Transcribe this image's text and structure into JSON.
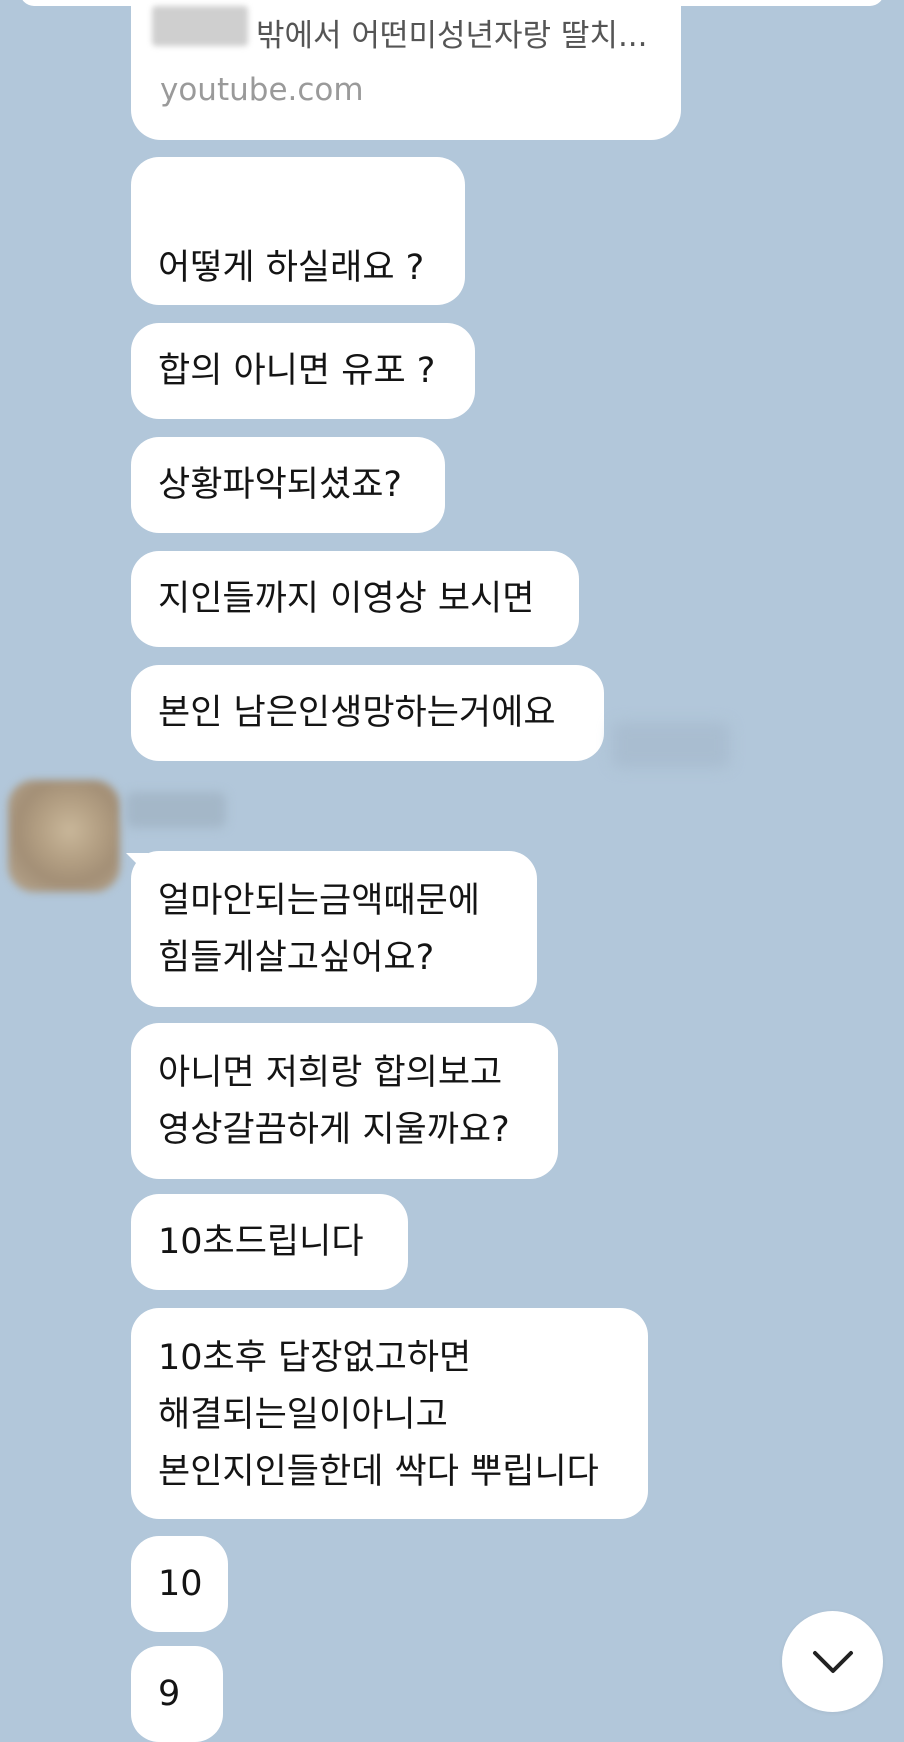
{
  "link_preview": {
    "title": "밖에서 어떤미성년자랑 딸치...",
    "domain": "youtube.com"
  },
  "messages": [
    "어떻게 하실래요 ?",
    "합의 아니면 유포 ?",
    "상황파악되셨죠?",
    "지인들까지 이영상 보시면",
    "본인 남은인생망하는거에요",
    "얼마안되는금액때문에\n힘들게살고싶어요?",
    "아니면 저희랑 합의보고\n영상갈끔하게 지울까요?",
    "10초드립니다",
    "10초후 답장없고하면\n해결되는일이아니고\n본인지인들한데 싹다 뿌립니다",
    "10",
    "9"
  ],
  "icons": {
    "scroll_down": "chevron-down-icon",
    "avatar": "avatar"
  },
  "colors": {
    "background": "#b2c7da",
    "bubble": "#ffffff"
  }
}
